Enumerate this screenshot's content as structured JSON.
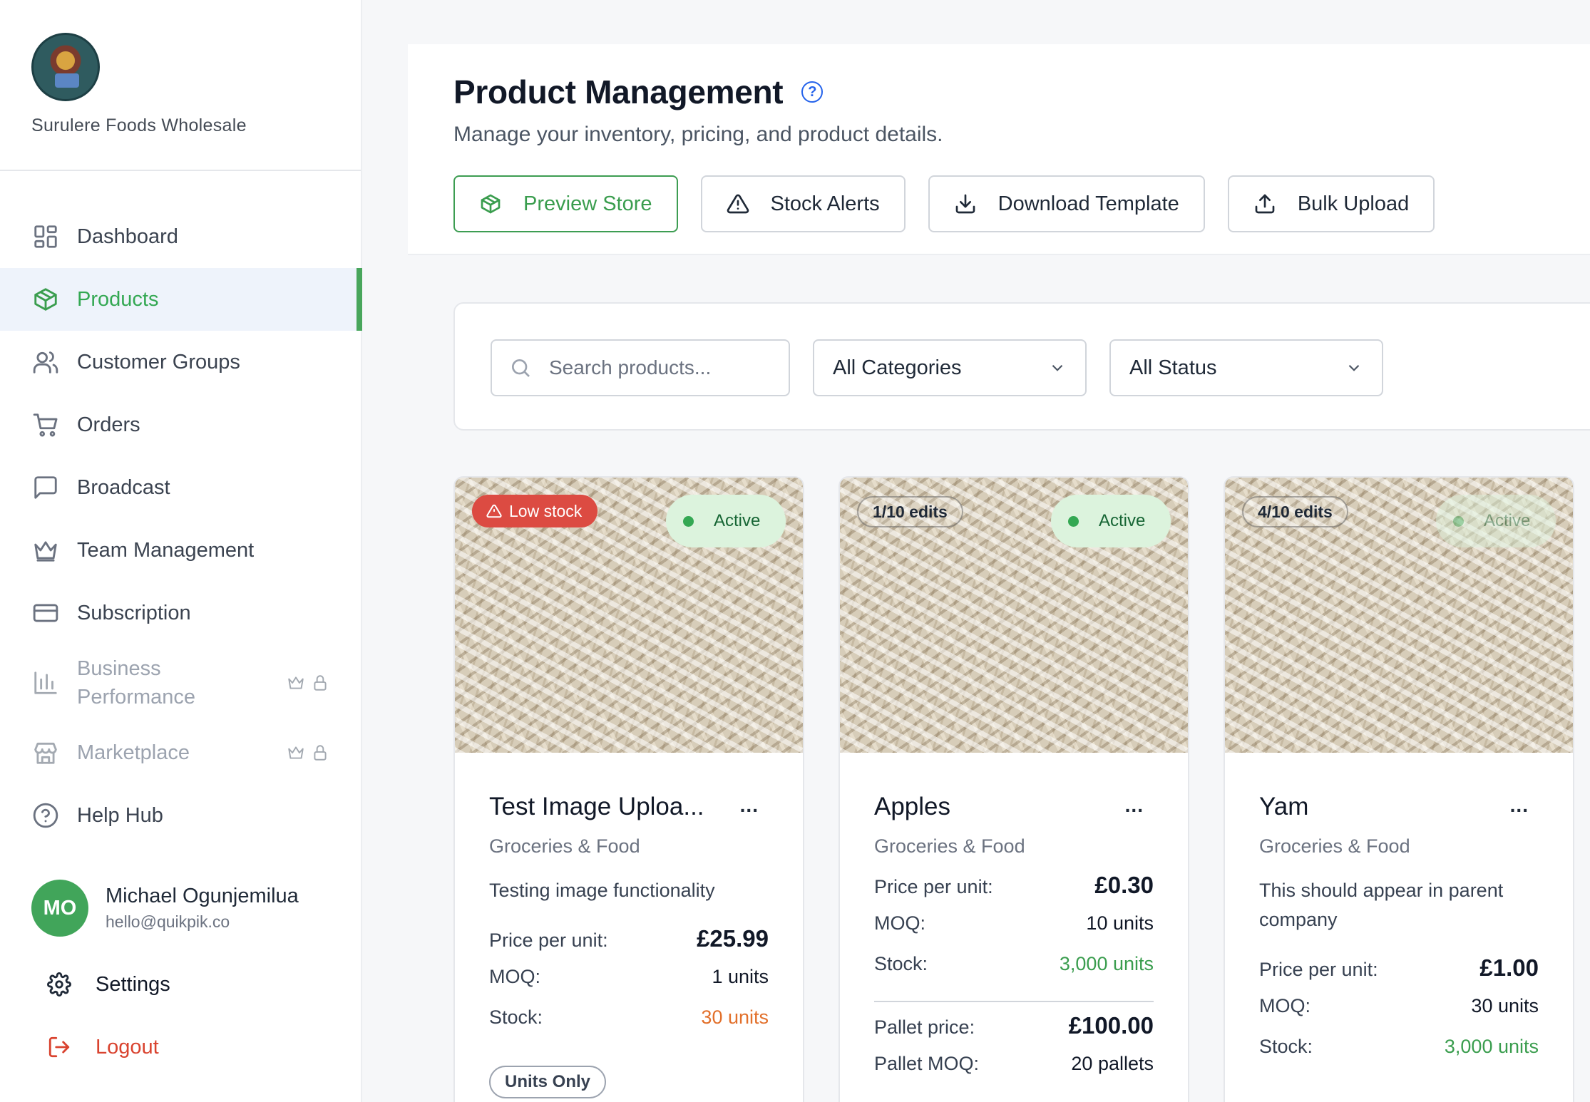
{
  "brand": {
    "name": "Surulere Foods Wholesale"
  },
  "sidebar": {
    "items": [
      {
        "label": "Dashboard",
        "icon": "grid-icon"
      },
      {
        "label": "Products",
        "icon": "box-icon"
      },
      {
        "label": "Customer Groups",
        "icon": "users-icon"
      },
      {
        "label": "Orders",
        "icon": "cart-icon"
      },
      {
        "label": "Broadcast",
        "icon": "message-icon"
      },
      {
        "label": "Team Management",
        "icon": "crown-icon"
      },
      {
        "label": "Subscription",
        "icon": "card-icon"
      },
      {
        "label": "Business Performance",
        "icon": "bar-chart-icon",
        "locked": true
      },
      {
        "label": "Marketplace",
        "icon": "store-icon",
        "locked": true
      },
      {
        "label": "Help Hub",
        "icon": "help-icon"
      }
    ],
    "active": "Products",
    "user": {
      "initials": "MO",
      "name": "Michael Ogunjemilua",
      "email": "hello@quikpik.co"
    },
    "settings_label": "Settings",
    "logout_label": "Logout"
  },
  "header": {
    "title": "Product Management",
    "help_glyph": "?",
    "subtitle": "Manage your inventory, pricing, and product details.",
    "buttons": {
      "preview": "Preview Store",
      "alerts": "Stock Alerts",
      "template": "Download Template",
      "upload": "Bulk Upload"
    }
  },
  "filters": {
    "search_placeholder": "Search products...",
    "category": "All Categories",
    "status": "All Status"
  },
  "colors": {
    "accent_green": "#3a9d4e",
    "low_stock_red": "#dc4b42",
    "stock_orange": "#e2702b"
  },
  "cards": [
    {
      "badge": "Low stock",
      "status": "Active",
      "title": "Test Image Uploa...",
      "menu": "...",
      "category": "Groceries & Food",
      "description": "Testing image functionality",
      "price_label": "Price per unit:",
      "price": "£25.99",
      "moq_label": "MOQ:",
      "moq": "1 units",
      "stock_label": "Stock:",
      "stock": "30 units",
      "pill": "Units Only"
    },
    {
      "badge": "1/10 edits",
      "status": "Active",
      "title": "Apples",
      "menu": "...",
      "category": "Groceries & Food",
      "price_label": "Price per unit:",
      "price": "£0.30",
      "moq_label": "MOQ:",
      "moq": "10 units",
      "stock_label": "Stock:",
      "stock": "3,000 units",
      "pallet_price_label": "Pallet price:",
      "pallet_price": "£100.00",
      "pallet_moq_label": "Pallet MOQ:",
      "pallet_moq": "20 pallets"
    },
    {
      "badge": "4/10 edits",
      "status": "Active",
      "title": "Yam",
      "menu": "...",
      "category": "Groceries & Food",
      "description": "This should appear in parent company",
      "price_label": "Price per unit:",
      "price": "£1.00",
      "moq_label": "MOQ:",
      "moq": "30 units",
      "stock_label": "Stock:",
      "stock": "3,000 units"
    }
  ]
}
